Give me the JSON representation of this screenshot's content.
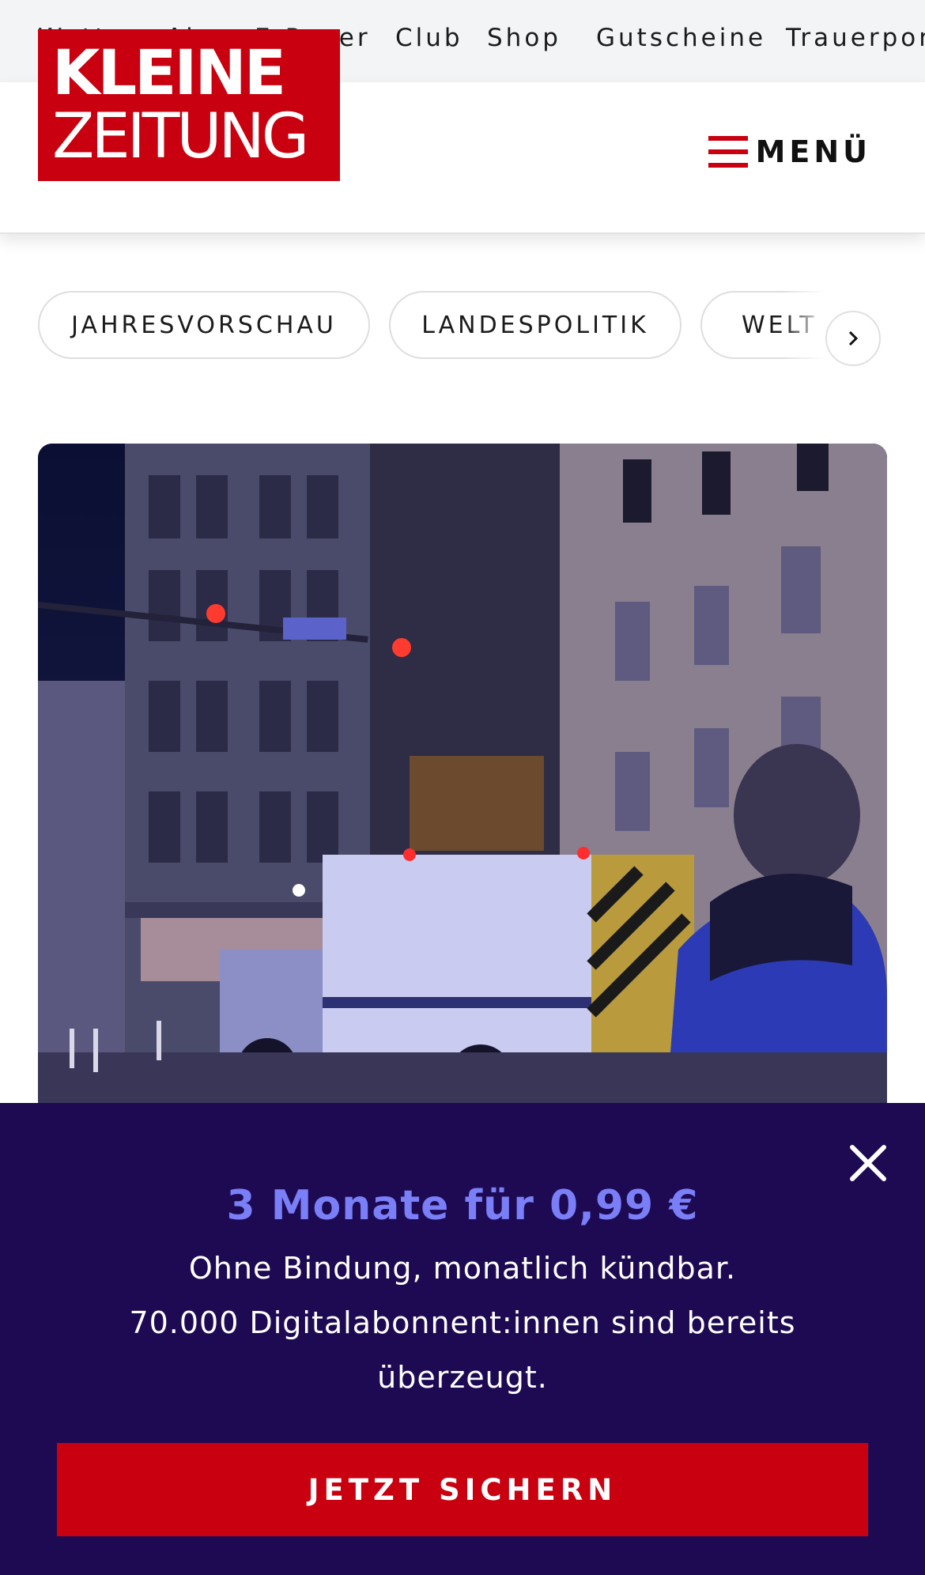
{
  "topnav": {
    "items": [
      "Wetter",
      "Abo",
      "E-Paper",
      "Club",
      "Shop",
      "Gutscheine",
      "Trauerportal"
    ]
  },
  "header": {
    "logo_line1": "KLEINE",
    "logo_line2": "ZEITUNG",
    "menu_label": "MENÜ",
    "brand_color": "#c8000f"
  },
  "categories": {
    "chips": [
      "JAHRESVORSCHAU",
      "LANDESPOLITIK",
      "WELT"
    ]
  },
  "hero": {
    "image_icon": "news-photo"
  },
  "paywall": {
    "offer": "3 Monate für 0,99 €",
    "line1": "Ohne Bindung, monatlich kündbar.",
    "line2": "70.000 Digitalabonnent:innen sind bereits überzeugt.",
    "cta_label": "JETZT SICHERN",
    "background_color": "#1d0a53",
    "accent_color": "#7a7ff7"
  }
}
